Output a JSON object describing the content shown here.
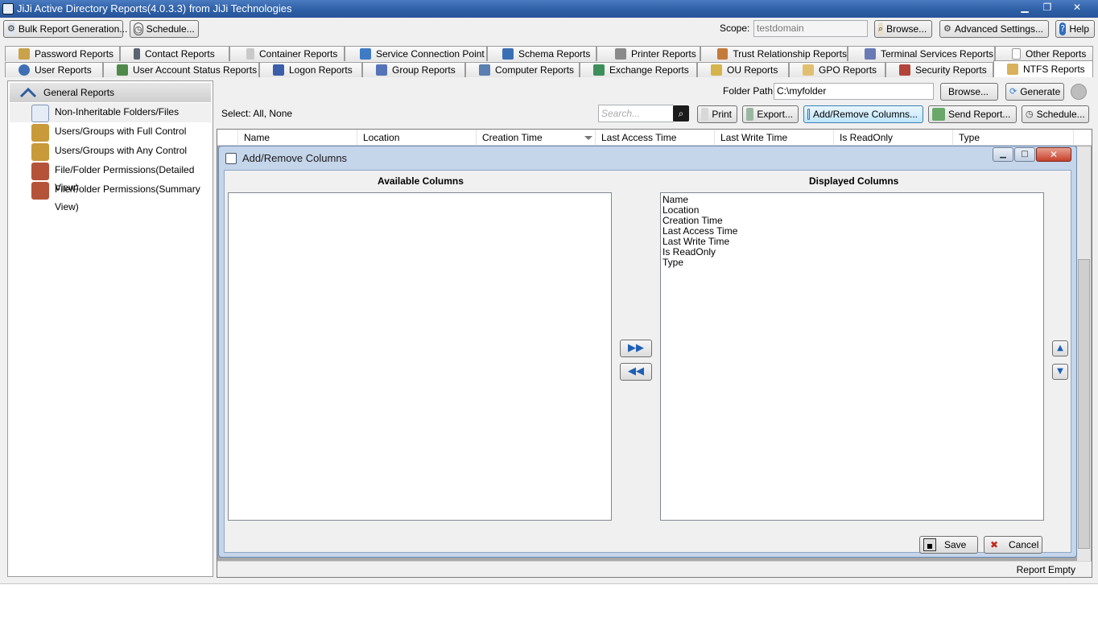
{
  "window": {
    "title": "JiJi Active Directory Reports(4.0.3.3) from JiJi Technologies",
    "minimize_glyph": "▁",
    "maximize_glyph": "❐",
    "close_glyph": "✕"
  },
  "toolbar": {
    "bulk_report_label": "Bulk Report Generation...",
    "schedule_label": "Schedule...",
    "scope_label": "Scope:",
    "scope_value": "testdomain",
    "browse_label": "Browse...",
    "advanced_settings_label": "Advanced  Settings...",
    "help_label": "Help"
  },
  "tabs_row1": [
    {
      "label": "Password Reports",
      "icon": "key-icon",
      "color": "#c9a24a"
    },
    {
      "label": "Contact Reports",
      "icon": "phone-icon",
      "color": "#5a6470"
    },
    {
      "label": "Container Reports",
      "icon": "container-icon",
      "color": "#c9c9c9"
    },
    {
      "label": "Service Connection Point",
      "icon": "satellite-icon",
      "color": "#3e7bc4"
    },
    {
      "label": "Schema Reports",
      "icon": "schema-icon",
      "color": "#3a6fb5"
    },
    {
      "label": "Printer Reports",
      "icon": "printer-icon",
      "color": "#8a8a8a"
    },
    {
      "label": "Trust Relationship Reports",
      "icon": "handshake-icon",
      "color": "#c47a3a"
    },
    {
      "label": "Terminal Services Reports",
      "icon": "terminal-icon",
      "color": "#6a7ab5"
    },
    {
      "label": "Other Reports",
      "icon": "document-icon",
      "color": "#bdbdbd"
    }
  ],
  "tabs_row2": [
    {
      "label": "User Reports",
      "icon": "user-icon",
      "color": "#3e6fb5"
    },
    {
      "label": "User Account Status Reports",
      "icon": "user-status-icon",
      "color": "#4f8a4a"
    },
    {
      "label": "Logon Reports",
      "icon": "logon-icon",
      "color": "#3a5fa8"
    },
    {
      "label": "Group Reports",
      "icon": "group-icon",
      "color": "#5574b8"
    },
    {
      "label": "Computer Reports",
      "icon": "computer-icon",
      "color": "#5a7fb0"
    },
    {
      "label": "Exchange Reports",
      "icon": "exchange-icon",
      "color": "#3c8f5a"
    },
    {
      "label": "OU Reports",
      "icon": "ou-icon",
      "color": "#d6b44c"
    },
    {
      "label": "GPO Reports",
      "icon": "gpo-icon",
      "color": "#e0c070"
    },
    {
      "label": "Security Reports",
      "icon": "security-icon",
      "color": "#b2443a"
    },
    {
      "label": "NTFS Reports",
      "icon": "ntfs-icon",
      "color": "#d9b15a"
    }
  ],
  "sidebar": {
    "header": "General Reports",
    "items": [
      {
        "label": "Non-Inheritable Folders/Files",
        "icon": "non-inheritable-icon",
        "color": "#7e95b8"
      },
      {
        "label": "Users/Groups with Full Control",
        "icon": "users-full-control-icon",
        "color": "#c89a3a"
      },
      {
        "label": "Users/Groups with Any Control",
        "icon": "users-any-control-icon",
        "color": "#c89a3a"
      },
      {
        "label": "File/Folder Permissions(Detailed View)",
        "icon": "permissions-detailed-icon",
        "color": "#b5533a"
      },
      {
        "label": "File/Folder Permissions(Summary View)",
        "icon": "permissions-summary-icon",
        "color": "#b5533a"
      }
    ]
  },
  "report": {
    "folder_path_label": "Folder Path:",
    "folder_path_value": "C:\\myfolder",
    "browse_label": "Browse...",
    "generate_label": "Generate",
    "select_label": "Select:  All,  None",
    "search_placeholder": "Search...",
    "print_label": "Print",
    "export_label": "Export...",
    "add_remove_label": "Add/Remove Columns...",
    "send_report_label": "Send Report...",
    "schedule_label": "Schedule...",
    "columns": [
      "Name",
      "Location",
      "Creation Time",
      "Last Access Time",
      "Last Write Time",
      "Is ReadOnly",
      "Type"
    ],
    "status": "Report Empty"
  },
  "dialog": {
    "title": "Add/Remove Columns",
    "available_title": "Available Columns",
    "displayed_title": "Displayed Columns",
    "available_items": [],
    "displayed_items": [
      "Name",
      "Location",
      "Creation Time",
      "Last Access Time",
      "Last Write Time",
      "Is ReadOnly",
      "Type"
    ],
    "move_right_glyph": "▶▶",
    "move_left_glyph": "◀◀",
    "move_up_glyph": "▲",
    "move_down_glyph": "▼",
    "save_label": "Save",
    "cancel_label": "Cancel",
    "minimize_glyph": "▁",
    "maximize_glyph": "□",
    "close_glyph": "✕"
  },
  "colors": {
    "title_bar": "#2c5ea5",
    "dialog_frame": "#c5d5ea",
    "accent": "#1d5fb5"
  }
}
